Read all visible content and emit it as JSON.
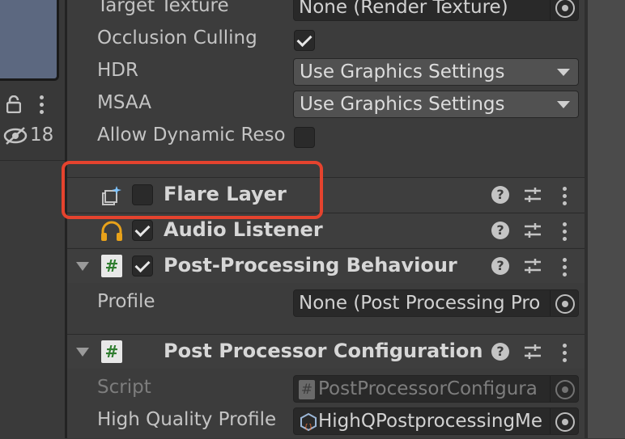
{
  "left": {
    "badge_count": "18"
  },
  "camera": {
    "target_texture": {
      "label": "Target Texture",
      "value": "None (Render Texture)"
    },
    "occlusion_culling": {
      "label": "Occlusion Culling",
      "checked": true
    },
    "hdr": {
      "label": "HDR",
      "value": "Use Graphics Settings"
    },
    "msaa": {
      "label": "MSAA",
      "value": "Use Graphics Settings"
    },
    "allow_dynamic": {
      "label": "Allow Dynamic Reso",
      "checked": false
    }
  },
  "components": {
    "flare_layer": {
      "title": "Flare Layer",
      "enabled": false
    },
    "audio_listener": {
      "title": "Audio Listener",
      "enabled": true
    },
    "post_processing_behaviour": {
      "title": "Post-Processing Behaviour",
      "enabled": true,
      "profile_label": "Profile",
      "profile_value": "None (Post Processing Pro"
    },
    "post_processor_configuration": {
      "title": "Post Processor Configuration",
      "script_label": "Script",
      "script_value": "PostProcessorConfigura",
      "hq_label": "High Quality Profile",
      "hq_value": "HighQPostprocessingMe"
    }
  },
  "icons": {
    "help": "?",
    "script_glyph": "#"
  },
  "colors": {
    "highlight": "#e5432e",
    "background": "#3c3c3c"
  }
}
